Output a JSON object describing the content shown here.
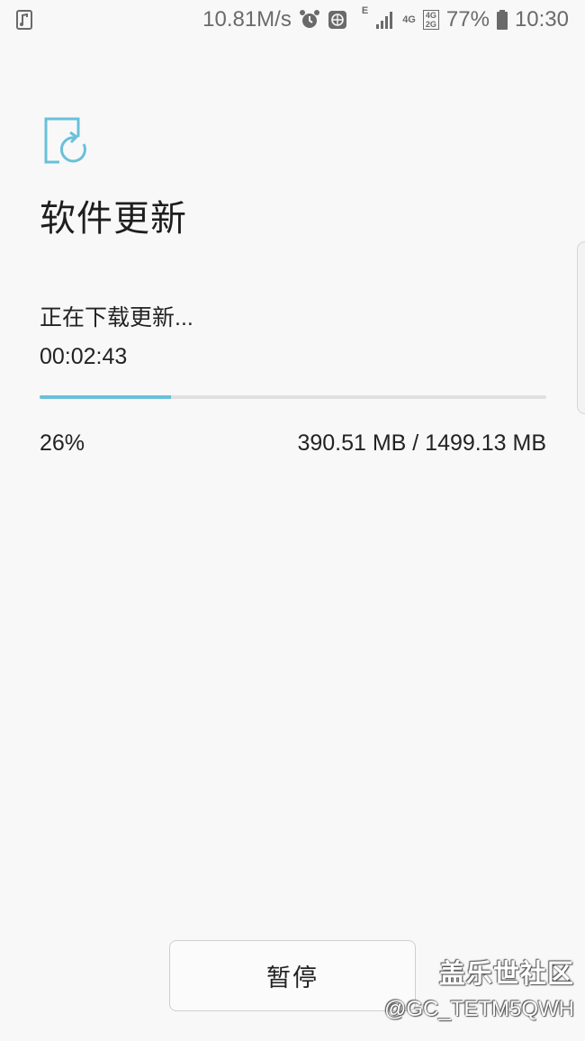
{
  "status_bar": {
    "speed": "10.81M/s",
    "network_e_label": "E",
    "network_4g_label": "4G",
    "network_2g_label": "2G",
    "battery": "77%",
    "time": "10:30",
    "icons": [
      "music-note-icon",
      "alarm-icon",
      "globe-icon",
      "signal-icon",
      "battery-icon"
    ]
  },
  "header": {
    "icon": "software-update-icon",
    "title": "软件更新"
  },
  "download": {
    "status": "正在下载更新...",
    "elapsed": "00:02:43",
    "progress_fraction": 0.26,
    "percent_label": "26%",
    "size_label": "390.51 MB / 1499.13 MB"
  },
  "actions": {
    "pause_label": "暂停"
  },
  "watermark": {
    "title": "盖乐世社区",
    "handle": "@GC_TETM5QWH"
  },
  "colors": {
    "accent": "#69c0d9",
    "background": "#f8f8f9",
    "track": "#e0e0e0"
  }
}
